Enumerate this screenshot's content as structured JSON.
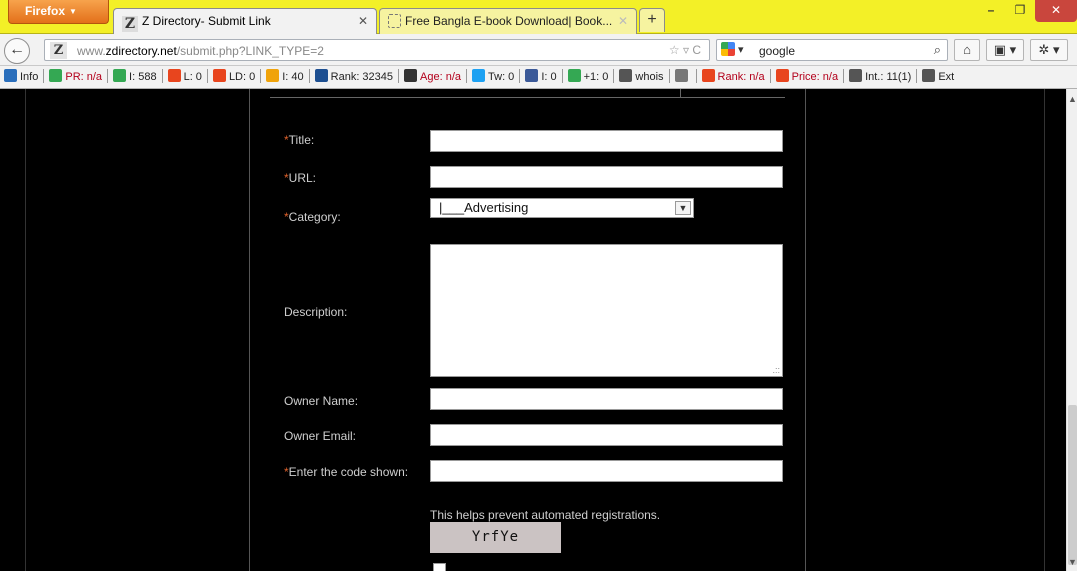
{
  "browser": {
    "menu_label": "Firefox",
    "tabs": [
      {
        "title": "Z Directory- Submit Link",
        "active": true
      },
      {
        "title": "Free Bangla E-book Download| Book...",
        "active": false
      }
    ],
    "new_tab_label": "+",
    "window_controls": {
      "minimize": "–",
      "maximize": "❐",
      "close": "✕"
    }
  },
  "navbar": {
    "back_label": "←",
    "url_prefix": "www.",
    "url_host": "zdirectory.net",
    "url_path": "/submit.php?LINK_TYPE=2",
    "url_actions": "☆ ▿ C",
    "search_query": "google",
    "search_go": "⌕",
    "home_label": "⌂",
    "bookmarks_label": "▣ ▾",
    "addon_label": "✲ ▾"
  },
  "seo_toolbar": {
    "items": [
      {
        "label": "Info",
        "icon": "info-icon",
        "color": "#2a6ebb"
      },
      {
        "label": "PR: n/a",
        "icon": "google-icon",
        "color": "#34a853",
        "red": true
      },
      {
        "label": "I: 588",
        "icon": "google-icon",
        "color": "#34a853"
      },
      {
        "label": "L: 0",
        "icon": "yahoo-icon",
        "color": "#e8451e"
      },
      {
        "label": "LD: 0",
        "icon": "yahoo-icon",
        "color": "#e8451e"
      },
      {
        "label": "I: 40",
        "icon": "bing-icon",
        "color": "#f0a30a"
      },
      {
        "label": "Rank: 32345",
        "icon": "alexa-icon",
        "color": "#1d4f91"
      },
      {
        "label": "Age: n/a",
        "icon": "barcode-icon",
        "color": "#333333",
        "red": true
      },
      {
        "label": "Tw: 0",
        "icon": "twitter-icon",
        "color": "#1da1f2"
      },
      {
        "label": "I: 0",
        "icon": "facebook-icon",
        "color": "#3b5998"
      },
      {
        "label": "+1: 0",
        "icon": "google-icon",
        "color": "#34a853"
      },
      {
        "label": "whois",
        "icon": "whois-icon",
        "color": "#555555"
      },
      {
        "label": "",
        "icon": "source-icon",
        "color": "#777777"
      },
      {
        "label": "Rank: n/a",
        "icon": "rank-icon",
        "color": "#e8451e",
        "red": true
      },
      {
        "label": "Price: n/a",
        "icon": "price-icon",
        "color": "#e8451e",
        "red": true
      },
      {
        "label": "Int.: 11(1)",
        "icon": "link-in-icon",
        "color": "#555555"
      },
      {
        "label": "Ext",
        "icon": "link-out-icon",
        "color": "#555555"
      }
    ]
  },
  "form": {
    "title_label": "Title:",
    "url_label": "URL:",
    "category_label": "Category:",
    "category_value": "|___Advertising",
    "description_label": "Description:",
    "owner_name_label": "Owner Name:",
    "owner_email_label": "Owner Email:",
    "code_label": "Enter the code shown:",
    "required_mark": "*",
    "captcha_hint": "This helps prevent automated registrations.",
    "captcha_text": "YrfYe"
  }
}
